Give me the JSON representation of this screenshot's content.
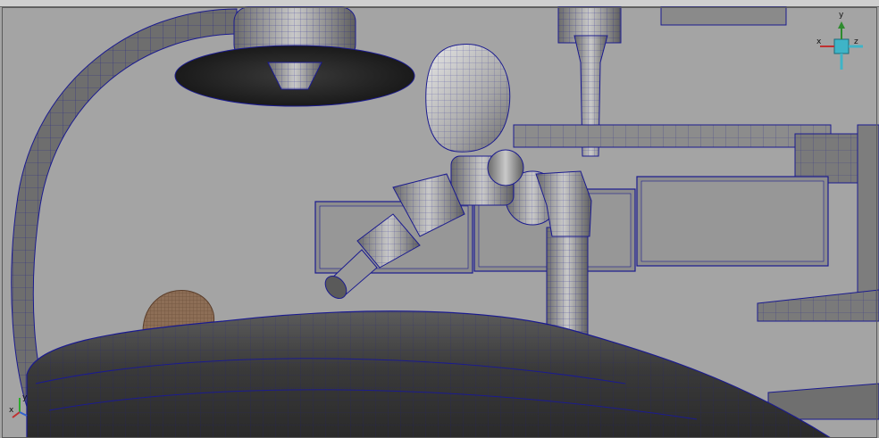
{
  "viewport": {
    "background": "#a4a4a4",
    "wire_color": "#1b1b8f",
    "camera_label": ""
  },
  "view_cube": {
    "top_label": "y",
    "left_label": "x",
    "right_label": "z"
  },
  "axis_indicator": {
    "up_label": "y",
    "side_label": "x"
  }
}
